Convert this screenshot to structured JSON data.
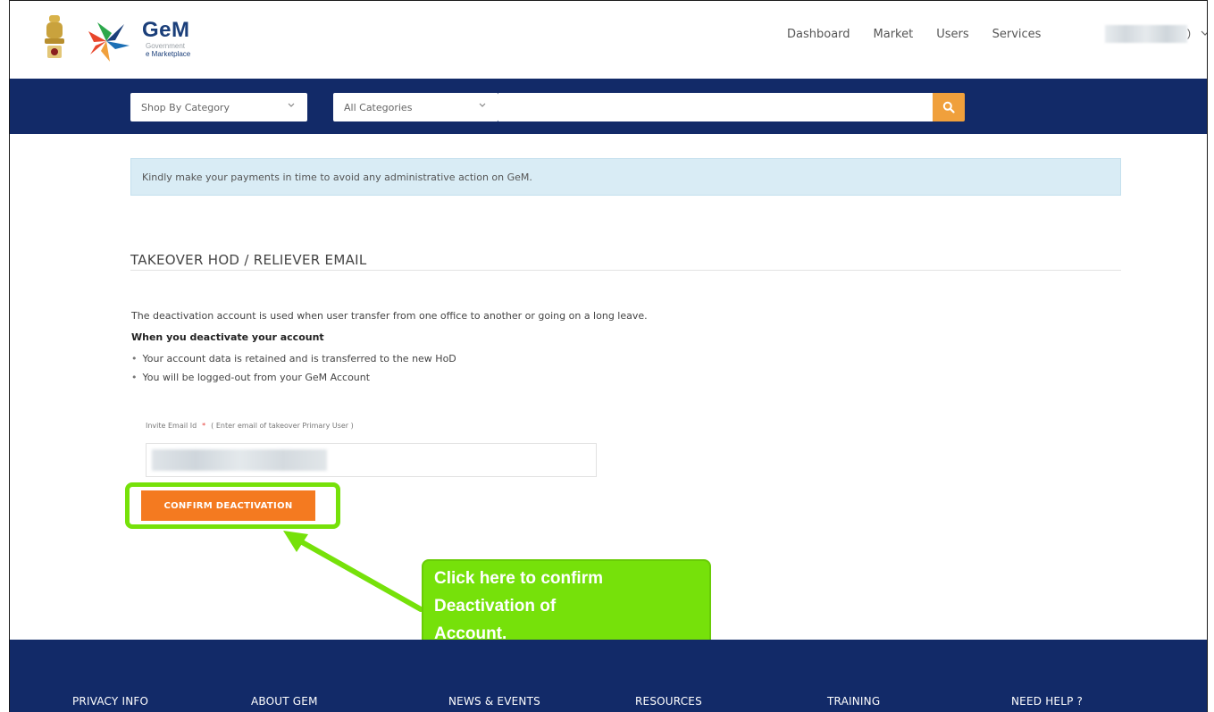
{
  "header": {
    "logo": {
      "name": "GeM",
      "line1": "Government",
      "line2": "e Marketplace"
    },
    "nav": [
      "Dashboard",
      "Market",
      "Users",
      "Services"
    ],
    "user_menu_suffix": ")",
    "user_menu_icon": "chevron-down-icon"
  },
  "searchbar": {
    "category_select": "Shop By Category",
    "filter_select": "All Categories",
    "search_placeholder": "",
    "search_button_icon": "search-icon",
    "accent_color": "#f0a03c",
    "bar_color": "#122a68"
  },
  "alert": {
    "text": "Kindly make your payments in time to avoid any administrative action on GeM."
  },
  "section": {
    "title": "TAKEOVER HOD / RELIEVER EMAIL",
    "description": "The deactivation account is used when user transfer from one office to another or going on a long leave.",
    "subheading": "When you deactivate your account",
    "bullets": [
      "Your account data is retained and is transferred to the new HoD",
      "You will be logged-out from your GeM Account"
    ],
    "field": {
      "label": "Invite Email Id",
      "required_mark": "*",
      "hint": "( Enter email of takeover Primary User )",
      "value": ""
    },
    "confirm_button": "CONFIRM DEACTIVATION",
    "confirm_color": "#f47a20"
  },
  "annotation": {
    "callout_lines": [
      "Click here to confirm",
      "Deactivation of",
      "Account."
    ],
    "highlight_color": "#76e10a"
  },
  "footer": {
    "links": [
      "PRIVACY INFO",
      "ABOUT GEM",
      "NEWS & EVENTS",
      "RESOURCES",
      "TRAINING",
      "NEED HELP ?"
    ]
  }
}
